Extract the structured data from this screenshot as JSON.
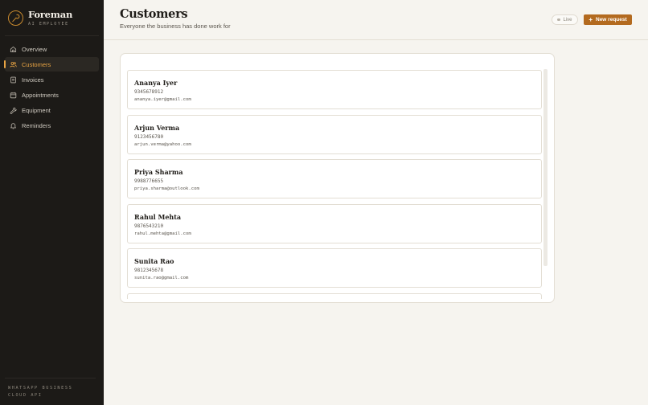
{
  "brand": {
    "name": "Foreman",
    "subtitle": "AI EMPLOYEE"
  },
  "nav": {
    "items": [
      {
        "label": "Overview",
        "icon": "home-icon"
      },
      {
        "label": "Customers",
        "icon": "users-icon",
        "active": true
      },
      {
        "label": "Invoices",
        "icon": "invoice-icon"
      },
      {
        "label": "Appointments",
        "icon": "calendar-icon"
      },
      {
        "label": "Equipment",
        "icon": "wrench-icon"
      },
      {
        "label": "Reminders",
        "icon": "bell-icon"
      }
    ]
  },
  "footer": {
    "text": "WHATSAPP BUSINESS CLOUD API"
  },
  "header": {
    "title": "Customers",
    "subtitle": "Everyone the business has done work for",
    "live_label": "Live",
    "new_request_label": "New request"
  },
  "customers": [
    {
      "name": "Ananya Iyer",
      "phone": "9345678912",
      "email": "ananya.iyer@gmail.com"
    },
    {
      "name": "Arjun Verma",
      "phone": "9123456780",
      "email": "arjun.verma@yahoo.com"
    },
    {
      "name": "Priya Sharma",
      "phone": "9988776655",
      "email": "priya.sharma@outlook.com"
    },
    {
      "name": "Rahul Mehta",
      "phone": "9876543210",
      "email": "rahul.mehta@gmail.com"
    },
    {
      "name": "Sunita Rao",
      "phone": "9812345678",
      "email": "sunita.rao@gmail.com"
    }
  ],
  "colors": {
    "accent": "#b36a1f",
    "active_nav": "#e9a443",
    "sidebar_bg": "#1c1a17"
  }
}
